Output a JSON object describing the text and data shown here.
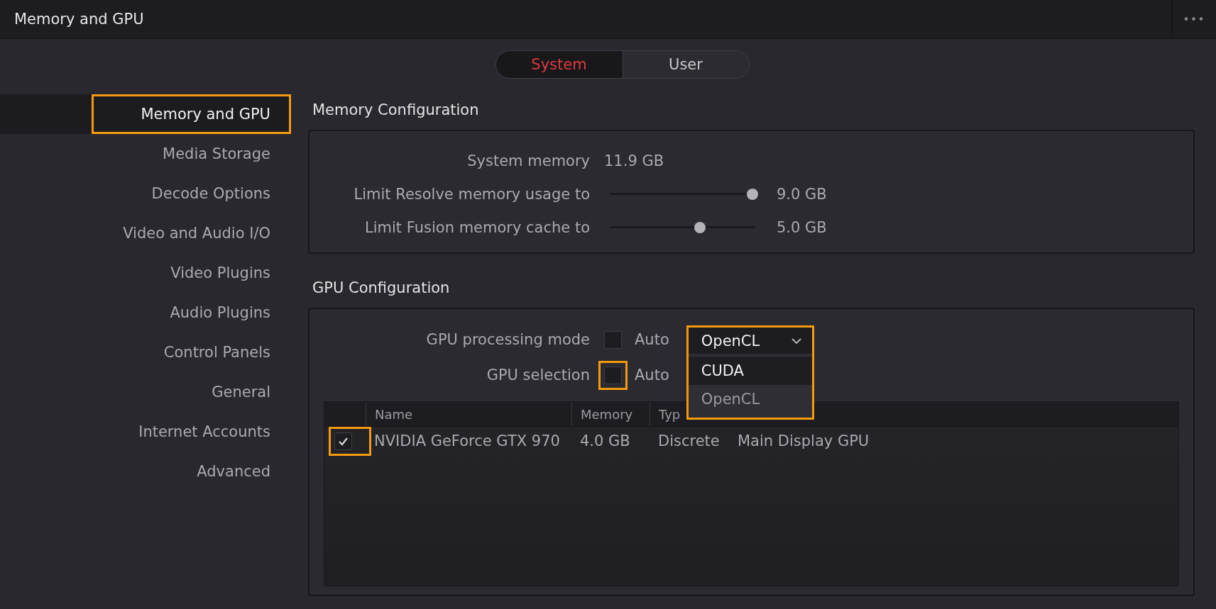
{
  "window": {
    "title": "Memory and GPU",
    "menu_button": "•••"
  },
  "tabs": [
    {
      "label": "System",
      "selected": true
    },
    {
      "label": "User",
      "selected": false
    }
  ],
  "sidebar": {
    "items": [
      {
        "label": "Memory and GPU",
        "selected": true,
        "highlighted": true
      },
      {
        "label": "Media Storage",
        "selected": false,
        "highlighted": false
      },
      {
        "label": "Decode Options",
        "selected": false,
        "highlighted": false
      },
      {
        "label": "Video and Audio I/O",
        "selected": false,
        "highlighted": false
      },
      {
        "label": "Video Plugins",
        "selected": false,
        "highlighted": false
      },
      {
        "label": "Audio Plugins",
        "selected": false,
        "highlighted": false
      },
      {
        "label": "Control Panels",
        "selected": false,
        "highlighted": false
      },
      {
        "label": "General",
        "selected": false,
        "highlighted": false
      },
      {
        "label": "Internet Accounts",
        "selected": false,
        "highlighted": false
      },
      {
        "label": "Advanced",
        "selected": false,
        "highlighted": false
      }
    ]
  },
  "memory_configuration": {
    "heading": "Memory Configuration",
    "rows": [
      {
        "kind": "text",
        "label": "System memory",
        "value": "11.9 GB"
      },
      {
        "kind": "slider",
        "label": "Limit Resolve memory usage to",
        "level": 0.98,
        "value": "9.0 GB"
      },
      {
        "kind": "slider",
        "label": "Limit Fusion memory cache to",
        "level": 0.62,
        "value": "5.0 GB"
      }
    ]
  },
  "gpu_configuration": {
    "heading": "GPU Configuration",
    "processing_mode": {
      "label": "GPU processing mode",
      "auto_checked": false,
      "auto_label": "Auto",
      "highlighted": false,
      "dropdown": {
        "value": "OpenCL",
        "expanded": true,
        "highlighted": true,
        "options": [
          {
            "label": "CUDA",
            "hovered": true
          },
          {
            "label": "OpenCL",
            "hovered": false
          }
        ]
      }
    },
    "gpu_selection": {
      "label": "GPU selection",
      "auto_checked": false,
      "auto_label": "Auto",
      "highlighted": true
    },
    "table": {
      "columns": [
        "Name",
        "Memory",
        "Typ"
      ],
      "rows": [
        {
          "checked": true,
          "highlighted": true,
          "cells": [
            "NVIDIA GeForce GTX 970",
            "4.0 GB",
            "Discrete",
            "Main Display GPU"
          ]
        }
      ]
    }
  }
}
